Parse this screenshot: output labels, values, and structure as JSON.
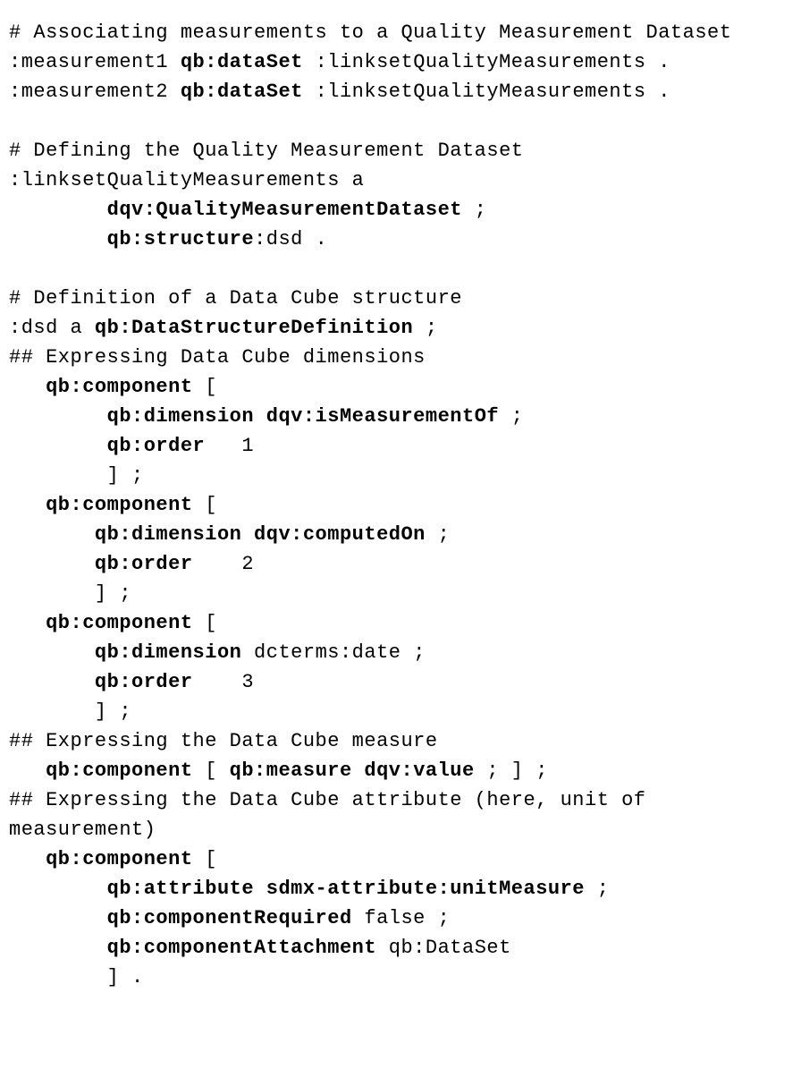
{
  "lines": [
    [
      {
        "t": "# Associating measurements to a Quality Measurement Dataset",
        "b": false
      }
    ],
    [
      {
        "t": ":measurement1 ",
        "b": false
      },
      {
        "t": "qb:dataSet",
        "b": true
      },
      {
        "t": " :linksetQualityMeasurements .",
        "b": false
      }
    ],
    [
      {
        "t": ":measurement2 ",
        "b": false
      },
      {
        "t": "qb:dataSet",
        "b": true
      },
      {
        "t": " :linksetQualityMeasurements .",
        "b": false
      }
    ],
    [
      {
        "t": "",
        "b": false
      }
    ],
    [
      {
        "t": "# Defining the Quality Measurement Dataset",
        "b": false
      }
    ],
    [
      {
        "t": ":linksetQualityMeasurements a",
        "b": false
      }
    ],
    [
      {
        "t": "        ",
        "b": false
      },
      {
        "t": "dqv:QualityMeasurementDataset",
        "b": true
      },
      {
        "t": " ;",
        "b": false
      }
    ],
    [
      {
        "t": "        ",
        "b": false
      },
      {
        "t": "qb:structure",
        "b": true
      },
      {
        "t": ":dsd .",
        "b": false
      }
    ],
    [
      {
        "t": "",
        "b": false
      }
    ],
    [
      {
        "t": "# Definition of a Data Cube structure",
        "b": false
      }
    ],
    [
      {
        "t": ":dsd a ",
        "b": false
      },
      {
        "t": "qb:DataStructureDefinition",
        "b": true
      },
      {
        "t": " ;",
        "b": false
      }
    ],
    [
      {
        "t": "## Expressing Data Cube dimensions",
        "b": false
      }
    ],
    [
      {
        "t": "   ",
        "b": false
      },
      {
        "t": "qb:component",
        "b": true
      },
      {
        "t": " [",
        "b": false
      }
    ],
    [
      {
        "t": "        ",
        "b": false
      },
      {
        "t": "qb:dimension dqv:isMeasurementOf",
        "b": true
      },
      {
        "t": " ;",
        "b": false
      }
    ],
    [
      {
        "t": "        ",
        "b": false
      },
      {
        "t": "qb:order",
        "b": true
      },
      {
        "t": "   1",
        "b": false
      }
    ],
    [
      {
        "t": "        ] ;",
        "b": false
      }
    ],
    [
      {
        "t": "   ",
        "b": false
      },
      {
        "t": "qb:component",
        "b": true
      },
      {
        "t": " [",
        "b": false
      }
    ],
    [
      {
        "t": "       ",
        "b": false
      },
      {
        "t": "qb:dimension dqv:computedOn",
        "b": true
      },
      {
        "t": " ;",
        "b": false
      }
    ],
    [
      {
        "t": "       ",
        "b": false
      },
      {
        "t": "qb:order",
        "b": true
      },
      {
        "t": "    2",
        "b": false
      }
    ],
    [
      {
        "t": "       ] ;",
        "b": false
      }
    ],
    [
      {
        "t": "   ",
        "b": false
      },
      {
        "t": "qb:component",
        "b": true
      },
      {
        "t": " [",
        "b": false
      }
    ],
    [
      {
        "t": "       ",
        "b": false
      },
      {
        "t": "qb:dimension",
        "b": true
      },
      {
        "t": " dcterms:date ;",
        "b": false
      }
    ],
    [
      {
        "t": "       ",
        "b": false
      },
      {
        "t": "qb:order",
        "b": true
      },
      {
        "t": "    3",
        "b": false
      }
    ],
    [
      {
        "t": "       ] ;",
        "b": false
      }
    ],
    [
      {
        "t": "## Expressing the Data Cube measure",
        "b": false
      }
    ],
    [
      {
        "t": "   ",
        "b": false
      },
      {
        "t": "qb:component",
        "b": true
      },
      {
        "t": " [ ",
        "b": false
      },
      {
        "t": "qb:measure dqv:value",
        "b": true
      },
      {
        "t": " ; ] ;",
        "b": false
      }
    ],
    [
      {
        "t": "## Expressing the Data Cube attribute (here, unit of measurement)",
        "b": false
      }
    ],
    [
      {
        "t": "   ",
        "b": false
      },
      {
        "t": "qb:component",
        "b": true
      },
      {
        "t": " [",
        "b": false
      }
    ],
    [
      {
        "t": "        ",
        "b": false
      },
      {
        "t": "qb:attribute sdmx-attribute:unitMeasure",
        "b": true
      },
      {
        "t": " ;",
        "b": false
      }
    ],
    [
      {
        "t": "        ",
        "b": false
      },
      {
        "t": "qb:componentRequired",
        "b": true
      },
      {
        "t": " false ;",
        "b": false
      }
    ],
    [
      {
        "t": "        ",
        "b": false
      },
      {
        "t": "qb:componentAttachment",
        "b": true
      },
      {
        "t": " qb:DataSet",
        "b": false
      }
    ],
    [
      {
        "t": "        ] .",
        "b": false
      }
    ]
  ]
}
